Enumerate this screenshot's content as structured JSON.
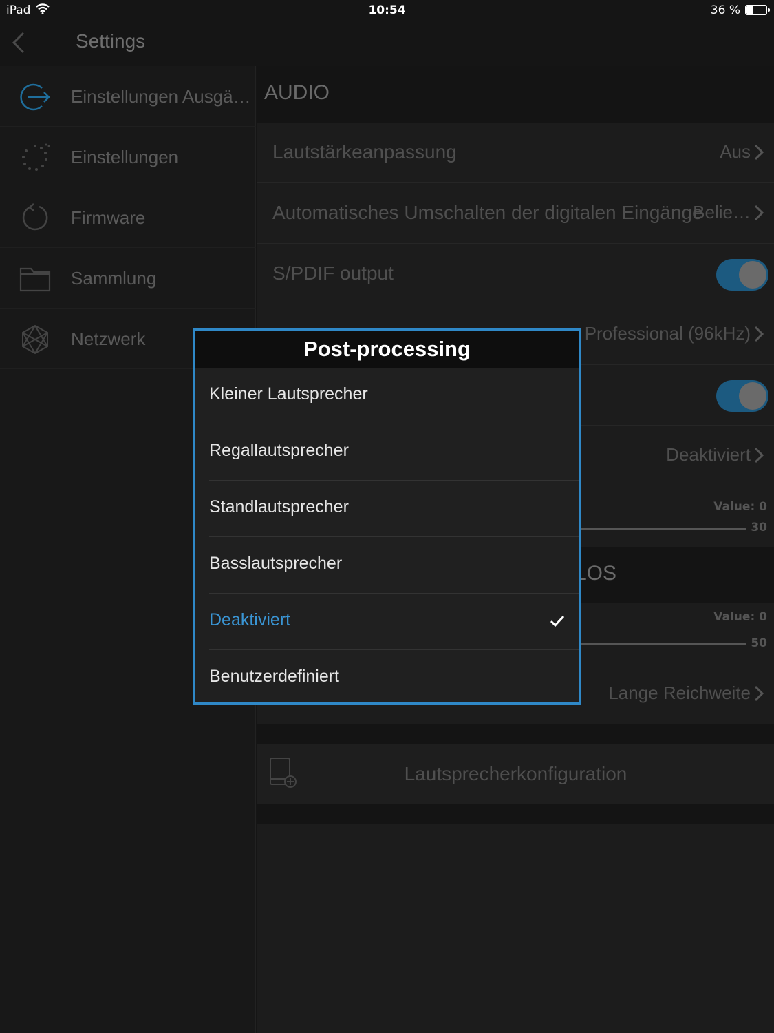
{
  "status_bar": {
    "carrier": "iPad",
    "time": "10:54",
    "battery_percent": "36 %",
    "battery_level": 0.36
  },
  "nav": {
    "title": "Settings"
  },
  "sidebar": {
    "items": [
      {
        "label": "Einstellungen Ausgä…",
        "icon": "output-icon",
        "active": true
      },
      {
        "label": "Einstellungen",
        "icon": "gear-dots-icon"
      },
      {
        "label": "Firmware",
        "icon": "refresh-icon"
      },
      {
        "label": "Sammlung",
        "icon": "folder-icon"
      },
      {
        "label": "Netzwerk",
        "icon": "network-icon"
      }
    ]
  },
  "main": {
    "section_audio": "AUDIO",
    "rows": {
      "volume": {
        "label": "Lautstärkeanpassung",
        "value": "Aus"
      },
      "auto_switch": {
        "label": "Automatisches Umschalten der digitalen Eingänge",
        "value": "Belie…"
      },
      "spdif_output": {
        "label": "S/PDIF output",
        "on": true
      },
      "spdif_mode": {
        "value": "Professional (96kHz)"
      },
      "toggle2": {
        "on": true
      },
      "postprocessing": {
        "value": "Deaktiviert"
      },
      "slider1": {
        "value_label": "Value: 0",
        "max": "30",
        "value": 0
      },
      "section2_partial": "LOS",
      "slider2": {
        "value_label": "Value: 0",
        "max": "50",
        "value": 0
      },
      "range": {
        "value": "Lange Reichweite"
      }
    },
    "speaker_config": "Lautsprecherkonfiguration"
  },
  "modal": {
    "title": "Post-processing",
    "options": [
      {
        "label": "Kleiner Lautsprecher"
      },
      {
        "label": "Regallautsprecher"
      },
      {
        "label": "Standlautsprecher"
      },
      {
        "label": "Basslautsprecher"
      },
      {
        "label": "Deaktiviert",
        "selected": true
      },
      {
        "label": "Benutzerdefiniert"
      }
    ]
  },
  "colors": {
    "accent": "#2f88c7",
    "selected_text": "#3a95d4",
    "toggle_track": "#1c5a80"
  }
}
